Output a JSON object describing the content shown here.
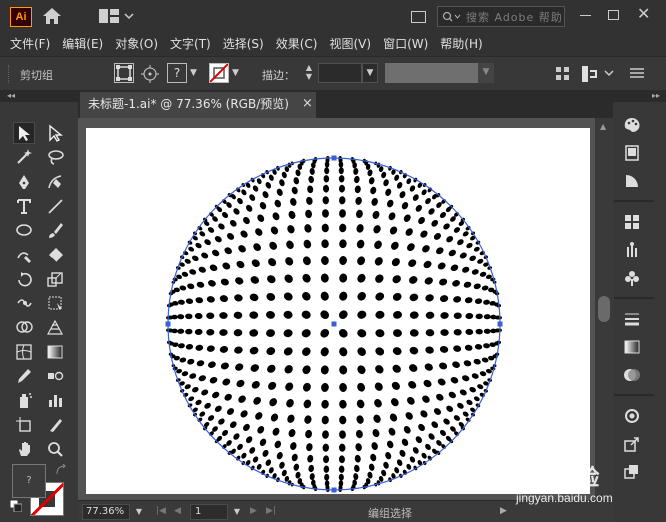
{
  "app": {
    "logo_text": "Ai",
    "search_placeholder": "搜索 Adobe 帮助",
    "brand_color": "#ff9a00"
  },
  "menubar": {
    "items": [
      "文件(F)",
      "编辑(E)",
      "对象(O)",
      "文字(T)",
      "选择(S)",
      "效果(C)",
      "视图(V)",
      "窗口(W)",
      "帮助(H)"
    ]
  },
  "controlbar": {
    "selection_label": "剪切组",
    "stroke_label": "描边：",
    "fill_toggle": "?",
    "stroke_color": "#e10000"
  },
  "document": {
    "tab_title": "未标题-1.ai* @ 77.36% (RGB/预览)",
    "close_glyph": "×"
  },
  "artwork": {
    "type": "halftone-dot-sphere",
    "dot_color": "#000000",
    "selection_color": "#3a5fd6",
    "background": "#ffffff"
  },
  "statusbar": {
    "zoom": "77.36%",
    "page": "1",
    "status_text": "编组选择"
  },
  "toolbar": {
    "tools": [
      "selection-tool",
      "direct-selection-tool",
      "magic-wand-tool",
      "lasso-tool",
      "pen-tool",
      "curvature-tool",
      "type-tool",
      "line-tool",
      "ellipse-tool",
      "paintbrush-tool",
      "shaper-tool",
      "eraser-tool",
      "rotate-tool",
      "scale-tool",
      "puppet-warp-tool",
      "free-transform-tool",
      "shape-builder-tool",
      "perspective-grid-tool",
      "mesh-tool",
      "gradient-tool",
      "eyedropper-tool",
      "blend-tool",
      "symbol-sprayer-tool",
      "column-graph-tool",
      "artboard-tool",
      "slice-tool",
      "hand-tool",
      "zoom-tool"
    ],
    "fill_placeholder": "?"
  },
  "right_panel": {
    "icons": [
      "color-icon",
      "swatches-icon",
      "color-guide-icon",
      "symbols-icon",
      "brushes-icon",
      "club-icon",
      "stroke-icon",
      "gradient-icon",
      "transparency-icon",
      "appearance-icon",
      "export-icon",
      "layers-icon"
    ]
  },
  "watermark": {
    "main": "Bai 经验",
    "sub": "jingyan.baidu.com"
  }
}
